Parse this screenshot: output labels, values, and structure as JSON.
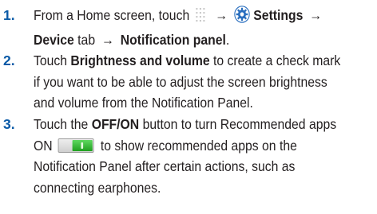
{
  "steps": [
    {
      "number": "1.",
      "line1_prefix": "From a Home screen, touch",
      "arrow": "→",
      "settings": "Settings",
      "device_tab": "Device",
      "tab_word": "tab",
      "notification_panel": "Notification panel",
      "period": "."
    },
    {
      "number": "2.",
      "touch": "Touch",
      "brightness_volume": "Brightness and volume",
      "line1_rest": "to create a check mark",
      "line2": "if you want to be able to adjust the screen brightness",
      "line3": "and volume from the Notification Panel."
    },
    {
      "number": "3.",
      "touch": "Touch the",
      "off_on": "OFF/ON",
      "line1_rest": "button to turn Recommended apps",
      "on_word": "ON",
      "line2_rest": "to show recommended apps on the",
      "line3": "Notification Panel after certain actions, such as",
      "line4": "connecting earphones."
    }
  ],
  "icons": {
    "apps": "apps-grid-icon",
    "settings": "settings-gear-icon",
    "toggle": "toggle-on-icon"
  },
  "colors": {
    "step_number": "#0a5aa7",
    "text": "#231f20",
    "settings_icon": "#2a6fbf",
    "toggle_on": "#33bb33"
  }
}
